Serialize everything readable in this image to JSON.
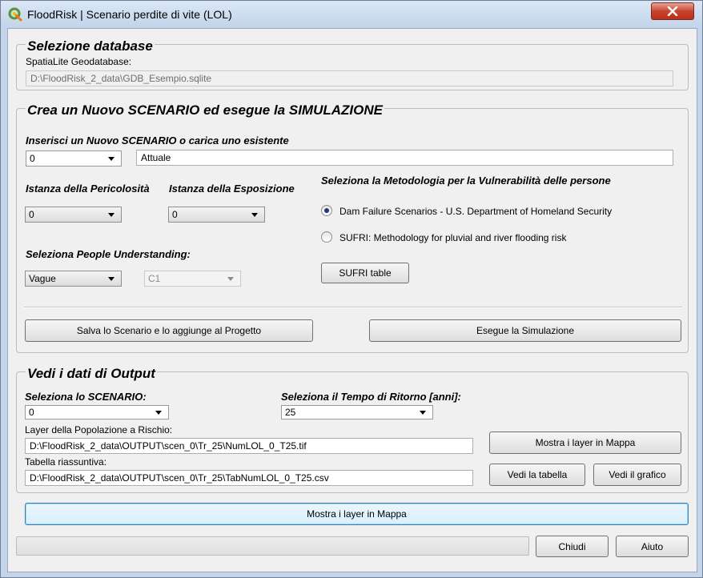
{
  "window": {
    "title": "FloodRisk | Scenario perdite di vite (LOL)"
  },
  "database": {
    "group_title": "Selezione database",
    "label": "SpatiaLite Geodatabase:",
    "path": "D:\\FloodRisk_2_data\\GDB_Esempio.sqlite"
  },
  "scenario": {
    "group_title": "Crea un Nuovo SCENARIO ed esegue la SIMULAZIONE",
    "insert_label": "Inserisci un Nuovo SCENARIO o carica uno esistente",
    "scenario_id": "0",
    "scenario_name": "Attuale",
    "hazard_label": "Istanza della Pericolosità",
    "hazard_value": "0",
    "exposure_label": "Istanza della Esposizione",
    "exposure_value": "0",
    "understanding_label": "Seleziona People Understanding:",
    "understanding_value": "Vague",
    "understanding_code": "C1",
    "method_label": "Seleziona la Metodologia per la Vulnerabilità delle persone",
    "method_option1": "Dam Failure Scenarios - U.S. Department of Homeland Security",
    "method_option2": "SUFRI: Methodology for pluvial and river flooding risk",
    "sufri_button": "SUFRI table",
    "save_button": "Salva lo Scenario e lo aggiunge al Progetto",
    "run_button": "Esegue la Simulazione"
  },
  "output": {
    "group_title": "Vedi i dati di Output",
    "scenario_label": "Seleziona lo SCENARIO:",
    "scenario_value": "0",
    "return_label": "Seleziona il Tempo di Ritorno [anni]:",
    "return_value": "25",
    "layer_label": "Layer della Popolazione a Rischio:",
    "layer_path": "D:\\FloodRisk_2_data\\OUTPUT\\scen_0\\Tr_25\\NumLOL_0_T25.tif",
    "table_label": "Tabella riassuntiva:",
    "table_path": "D:\\FloodRisk_2_data\\OUTPUT\\scen_0\\Tr_25\\TabNumLOL_0_T25.csv",
    "show_layer_button": "Mostra i layer in Mappa",
    "view_table_button": "Vedi la tabella",
    "view_chart_button": "Vedi il grafico"
  },
  "footer": {
    "show_layer_button": "Mostra i layer in Mappa",
    "progress": 0,
    "close_button": "Chiudi",
    "help_button": "Aiuto"
  }
}
